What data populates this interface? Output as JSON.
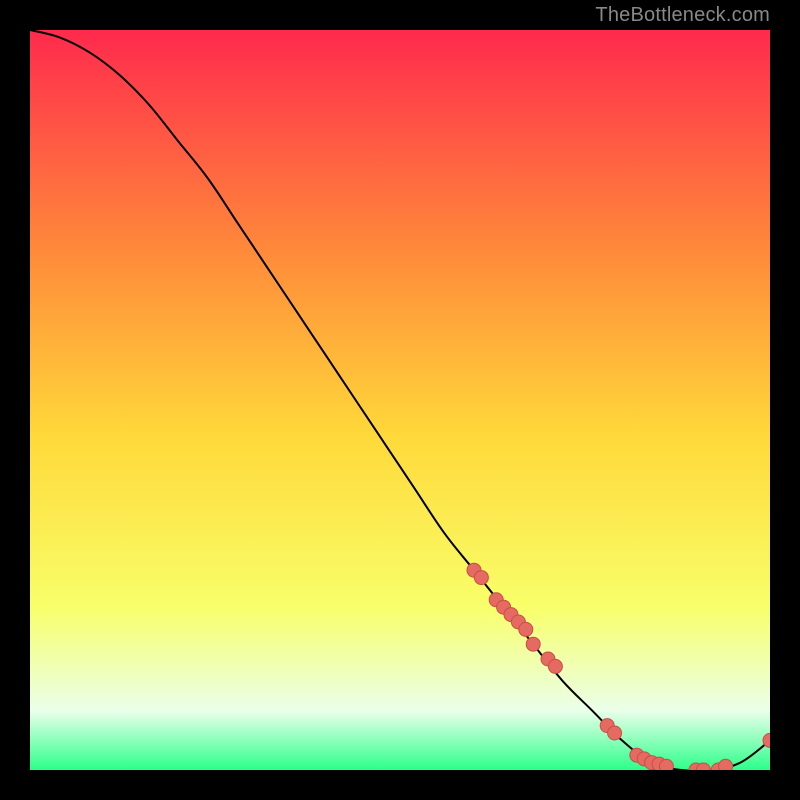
{
  "watermark": "TheBottleneck.com",
  "colors": {
    "bg": "#000000",
    "grad_top": "#ff2a4d",
    "grad_mid1": "#ff8a3a",
    "grad_mid2": "#ffd93a",
    "grad_mid3": "#f8ff6a",
    "grad_bottom_band_light": "#eaffea",
    "grad_bottom": "#2cff8a",
    "line": "#000000",
    "marker_fill": "#e46a62",
    "marker_stroke": "#c94e46"
  },
  "chart_data": {
    "type": "line",
    "title": "",
    "xlabel": "",
    "ylabel": "",
    "xlim": [
      0,
      100
    ],
    "ylim": [
      0,
      100
    ],
    "series": [
      {
        "name": "curve",
        "x": [
          0,
          4,
          8,
          12,
          16,
          20,
          24,
          28,
          32,
          36,
          40,
          44,
          48,
          52,
          56,
          60,
          64,
          68,
          72,
          76,
          80,
          84,
          88,
          92,
          96,
          100
        ],
        "y": [
          100,
          99,
          97,
          94,
          90,
          85,
          80,
          74,
          68,
          62,
          56,
          50,
          44,
          38,
          32,
          27,
          22,
          17,
          12,
          8,
          4,
          1,
          0,
          0,
          1,
          4
        ]
      }
    ],
    "markers": {
      "name": "highlight-points",
      "x": [
        60,
        61,
        63,
        64,
        65,
        66,
        67,
        68,
        70,
        71,
        78,
        79,
        82,
        83,
        84,
        85,
        86,
        90,
        91,
        93,
        94,
        100
      ],
      "y": [
        27,
        26,
        23,
        22,
        21,
        20,
        19,
        17,
        15,
        14,
        6,
        5,
        2,
        1.5,
        1,
        0.8,
        0.5,
        0,
        0,
        0,
        0.5,
        4
      ]
    }
  }
}
